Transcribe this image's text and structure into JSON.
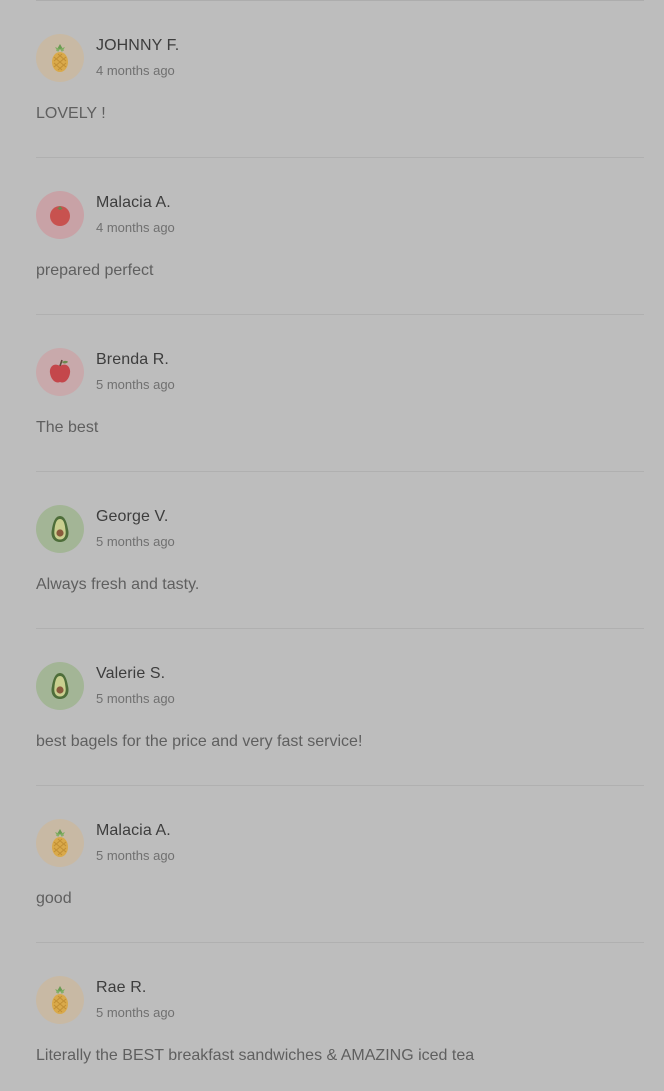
{
  "reviews": [
    {
      "name": "JOHNNY F.",
      "time": "4 months ago",
      "text": "LOVELY !",
      "avatar_icon": "pineapple-icon"
    },
    {
      "name": "Malacia A.",
      "time": "4 months ago",
      "text": "prepared perfect",
      "avatar_icon": "tomato-icon"
    },
    {
      "name": "Brenda R.",
      "time": "5 months ago",
      "text": "The best",
      "avatar_icon": "apple-icon"
    },
    {
      "name": "George V.",
      "time": "5 months ago",
      "text": "Always fresh and tasty.",
      "avatar_icon": "avocado-icon"
    },
    {
      "name": "Valerie S.",
      "time": "5 months ago",
      "text": "best bagels for the price and very fast service!",
      "avatar_icon": "avocado-icon"
    },
    {
      "name": "Malacia A.",
      "time": "5 months ago",
      "text": "good",
      "avatar_icon": "pineapple-icon"
    },
    {
      "name": "Rae R.",
      "time": "5 months ago",
      "text": "Literally the BEST breakfast sandwiches & AMAZING iced tea",
      "avatar_icon": "pineapple-icon"
    }
  ],
  "colors": {
    "background": "#bdbdbd",
    "name_text": "#3d3d3d",
    "time_text": "#707070",
    "body_text": "#5f5f5f"
  }
}
